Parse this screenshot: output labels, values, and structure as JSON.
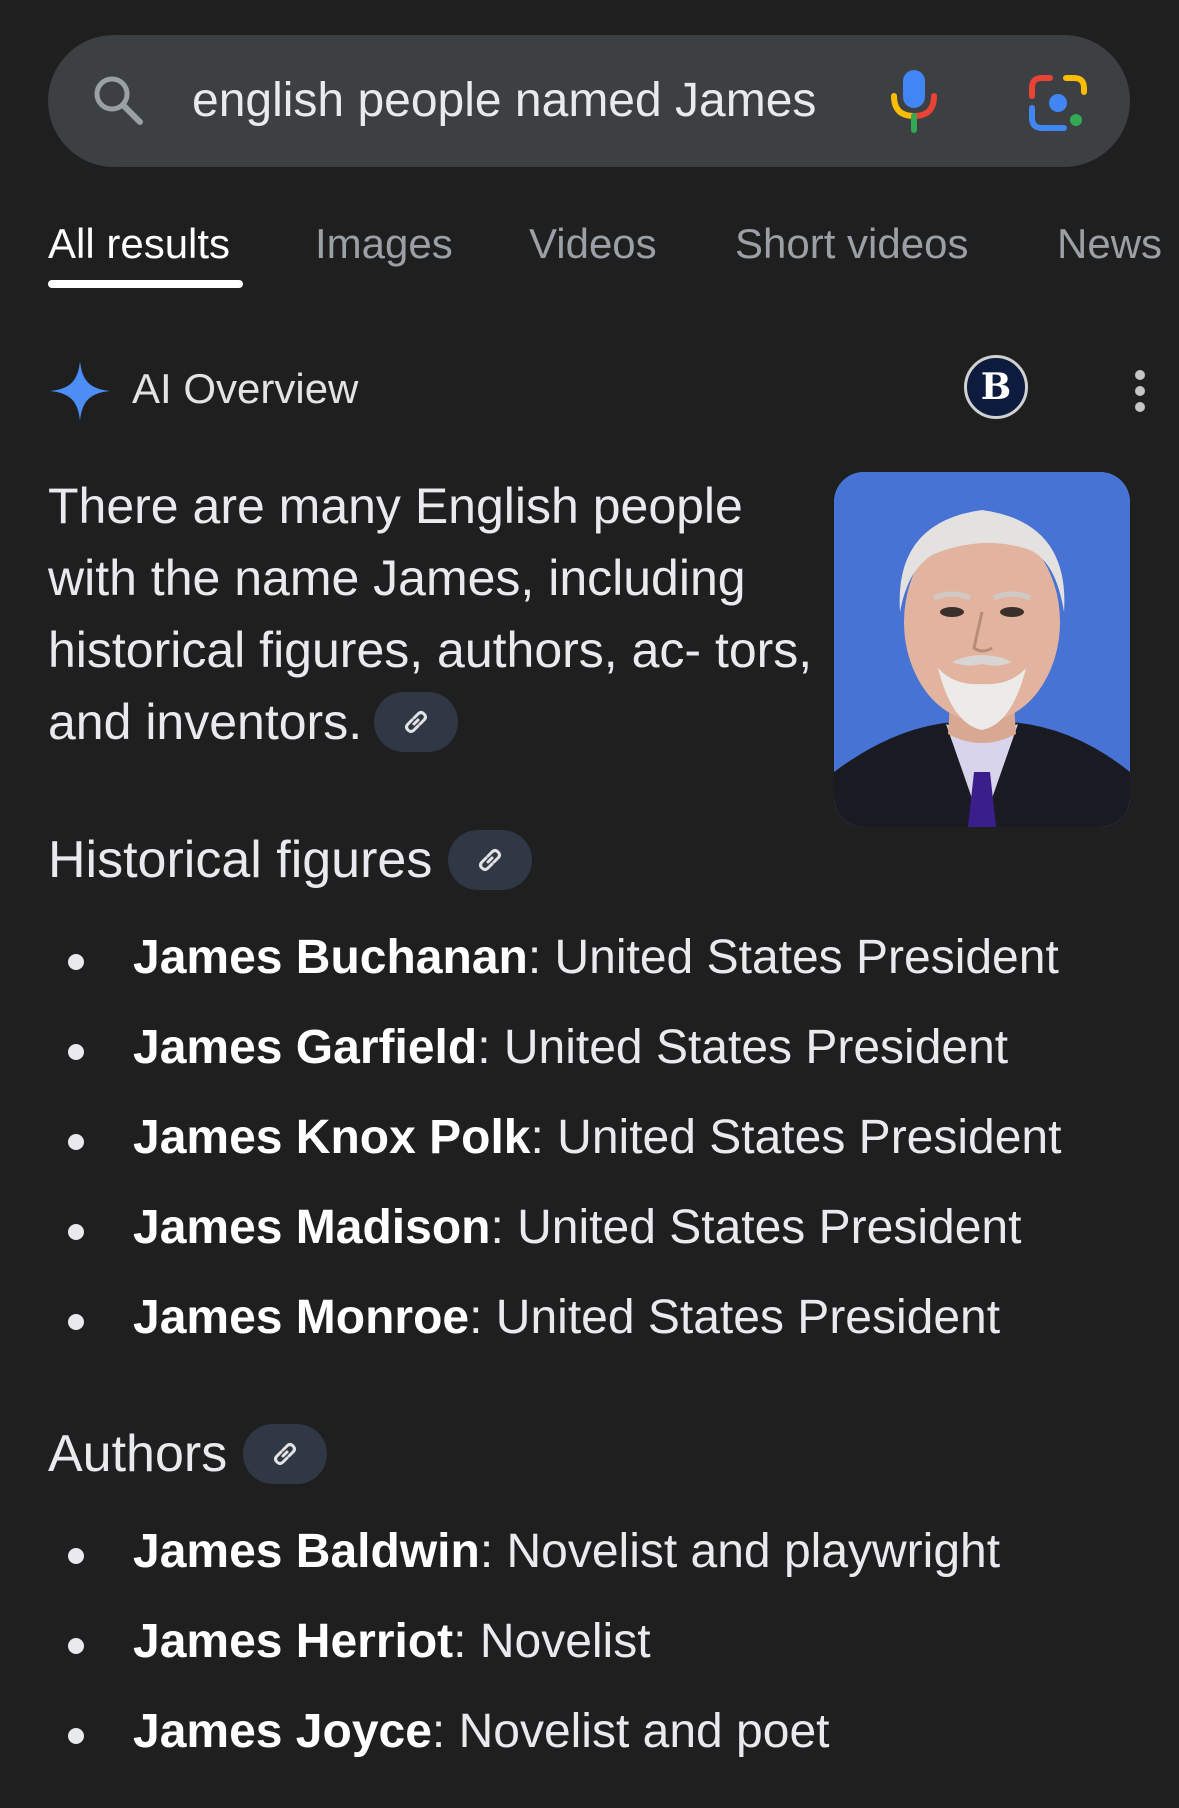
{
  "search": {
    "query": "english people named James"
  },
  "tabs": [
    {
      "label": "All results",
      "active": true
    },
    {
      "label": "Images",
      "active": false
    },
    {
      "label": "Videos",
      "active": false
    },
    {
      "label": "Short videos",
      "active": false
    },
    {
      "label": "News",
      "active": false
    }
  ],
  "ai_overview": {
    "title": "AI Overview",
    "badge_letter": "B",
    "intro_text": "There are many English people with the name James, including historical figures, authors, ac- tors, and inventors.",
    "icons": {
      "sparkle": "sparkle-icon",
      "link": "link-icon",
      "more": "more-vert-icon"
    }
  },
  "sections": [
    {
      "heading": "Historical figures",
      "items": [
        {
          "name": "James Buchanan",
          "desc": ": United States President"
        },
        {
          "name": "James Garfield",
          "desc": ": United States President"
        },
        {
          "name": "James Knox Polk",
          "desc": ": United States President"
        },
        {
          "name": "James Madison",
          "desc": ": United States President"
        },
        {
          "name": "James Monroe",
          "desc": ": United States President"
        }
      ]
    },
    {
      "heading": "Authors",
      "items": [
        {
          "name": "James Baldwin",
          "desc": ": Novelist and playwright"
        },
        {
          "name": "James Herriot",
          "desc": ": Novelist"
        },
        {
          "name": "James Joyce",
          "desc": ": Novelist and poet"
        }
      ]
    }
  ],
  "colors": {
    "background": "#1f1f1f",
    "search_bar": "#3c4043",
    "chip": "#303846",
    "sparkle": "#4c8df6"
  }
}
